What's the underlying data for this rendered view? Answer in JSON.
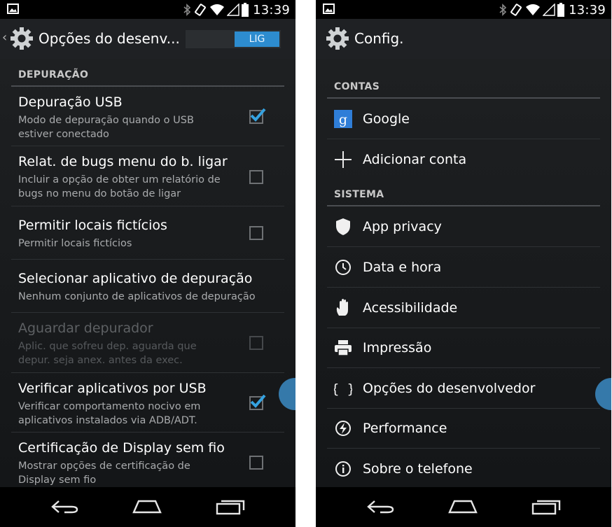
{
  "colors": {
    "accent": "#2d8ccf",
    "background": "#121416",
    "bar": "#1f2124"
  },
  "status_bar": {
    "time": "13:39",
    "icons": [
      "image-icon",
      "bluetooth-icon",
      "vibrate-icon",
      "wifi-icon",
      "signal-icon",
      "battery-icon"
    ]
  },
  "left": {
    "header": {
      "title": "Opções do desenv...",
      "toggle_label": "LIG"
    },
    "section": "DEPURAÇÃO",
    "items": [
      {
        "title": "Depuração USB",
        "subtitle": [
          "Modo de depuração quando o USB",
          "estiver conectado"
        ],
        "checked": true,
        "enabled": true
      },
      {
        "title": "Relat. de bugs menu do b. ligar",
        "subtitle": [
          "Incluir a opção de obter um relatório de",
          "bugs no menu do botão de ligar"
        ],
        "checked": false,
        "enabled": true
      },
      {
        "title": "Permitir locais fictícios",
        "subtitle": [
          "Permitir locais fictícios"
        ],
        "checked": false,
        "enabled": true
      },
      {
        "title": "Selecionar aplicativo de depuração",
        "subtitle": [
          "Nenhum conjunto de aplicativos de depuração"
        ],
        "checked": null,
        "enabled": true
      },
      {
        "title": "Aguardar depurador",
        "subtitle": [
          "Aplic. que sofreu dep. aguarda que",
          "depur. seja anex. antes da exec."
        ],
        "checked": false,
        "enabled": false
      },
      {
        "title": "Verificar aplicativos por USB",
        "subtitle": [
          "Verificar comportamento nocivo em",
          "aplicativos instalados via ADB/ADT."
        ],
        "checked": true,
        "enabled": true
      },
      {
        "title": "Certificação de Display sem fio",
        "subtitle": [
          "Mostrar opções de certificação de",
          "Display sem fio"
        ],
        "checked": false,
        "enabled": true
      }
    ]
  },
  "right": {
    "header": {
      "title": "Config."
    },
    "accounts_section": "CONTAS",
    "accounts": [
      {
        "icon": "google-icon",
        "label": "Google"
      },
      {
        "icon": "plus-icon",
        "label": "Adicionar conta"
      }
    ],
    "system_section": "SISTEMA",
    "system": [
      {
        "icon": "shield-icon",
        "label": "App privacy"
      },
      {
        "icon": "clock-icon",
        "label": "Data e hora"
      },
      {
        "icon": "hand-icon",
        "label": "Acessibilidade"
      },
      {
        "icon": "printer-icon",
        "label": "Impressão"
      },
      {
        "icon": "braces-icon",
        "label": "Opções do desenvolvedor"
      },
      {
        "icon": "bolt-icon",
        "label": "Performance"
      },
      {
        "icon": "info-icon",
        "label": "Sobre o telefone"
      }
    ]
  },
  "nav_bar": {
    "buttons": [
      "back-icon",
      "home-icon",
      "recents-icon"
    ]
  }
}
